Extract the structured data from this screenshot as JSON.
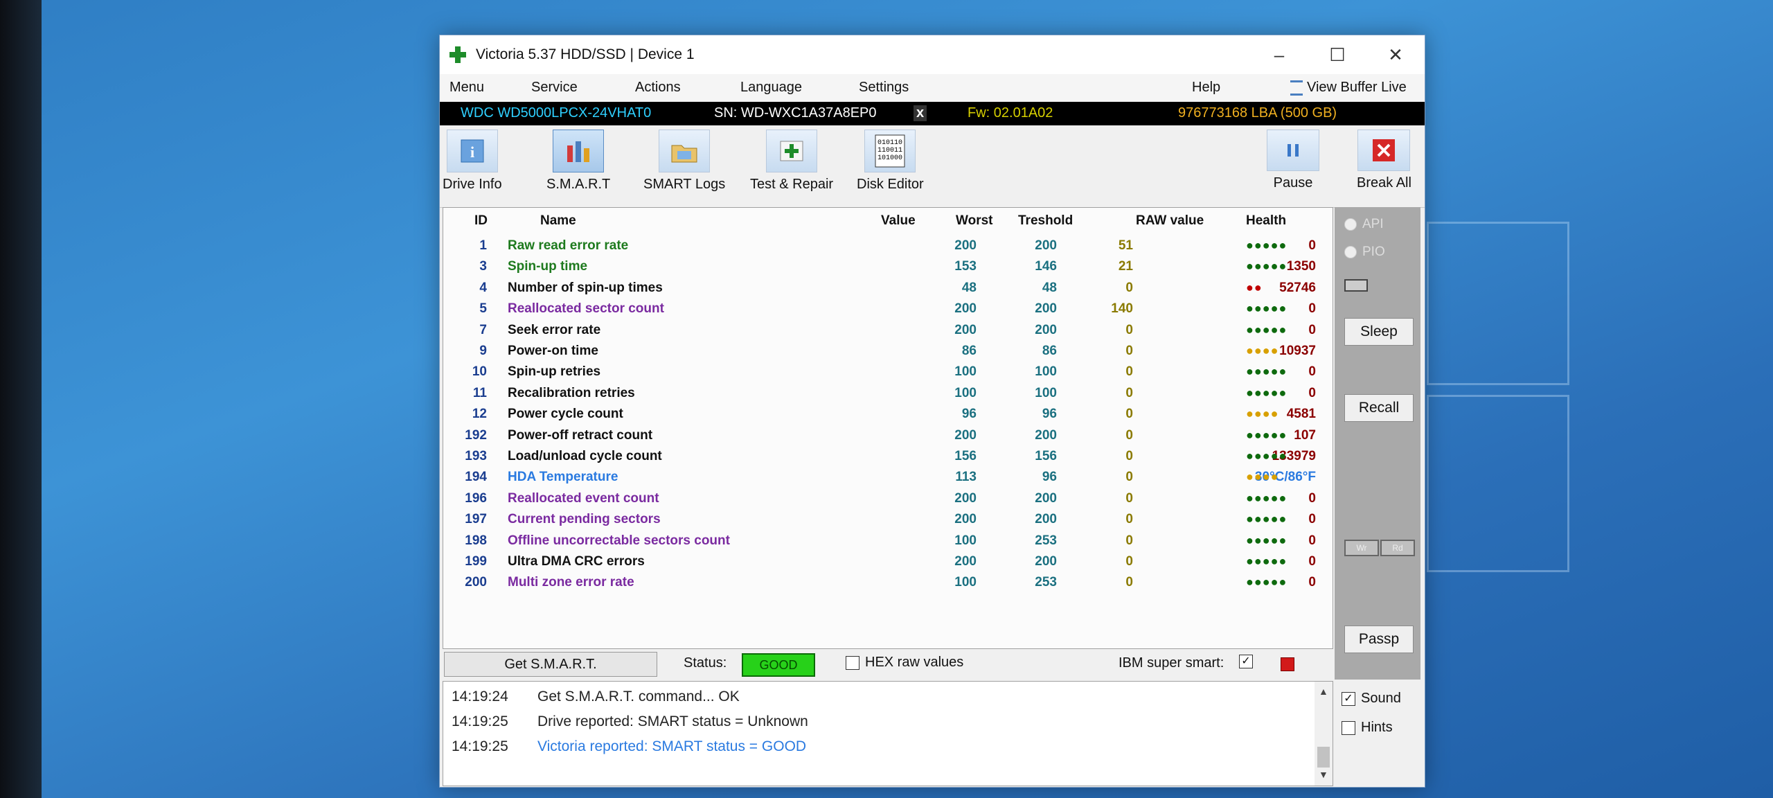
{
  "window": {
    "title": "Victoria 5.37 HDD/SSD | Device 1",
    "controls": {
      "minimize": "–",
      "maximize": "☐",
      "close": "✕"
    }
  },
  "menu": {
    "items": [
      "Menu",
      "Service",
      "Actions",
      "Language",
      "Settings"
    ],
    "help": "Help",
    "view_buffer": "View Buffer Live"
  },
  "drive": {
    "model": "WDC WD5000LPCX-24VHAT0",
    "serial": "SN: WD-WXC1A37A8EP0",
    "close_mark": "x",
    "firmware": "Fw: 02.01A02",
    "lba": "976773168 LBA (500 GB)"
  },
  "toolbar": {
    "drive_info": "Drive Info",
    "smart": "S.M.A.R.T",
    "smart_logs": "SMART Logs",
    "test_repair": "Test & Repair",
    "disk_editor": "Disk Editor",
    "pause": "Pause",
    "break_all": "Break All"
  },
  "table": {
    "headers": {
      "id": "ID",
      "name": "Name",
      "value": "Value",
      "worst": "Worst",
      "threshold": "Treshold",
      "raw": "RAW value",
      "health": "Health"
    },
    "rows": [
      {
        "id": "1",
        "name": "Raw read error rate",
        "value": "200",
        "worst": "200",
        "threshold": "51",
        "raw": "0",
        "health": "●●●●●",
        "name_color": "#1e7a1e",
        "health_color": "#0e6a0e"
      },
      {
        "id": "3",
        "name": "Spin-up time",
        "value": "153",
        "worst": "146",
        "threshold": "21",
        "raw": "1350",
        "health": "●●●●●",
        "name_color": "#1e7a1e",
        "health_color": "#0e6a0e"
      },
      {
        "id": "4",
        "name": "Number of spin-up times",
        "value": "48",
        "worst": "48",
        "threshold": "0",
        "raw": "52746",
        "health": "●●",
        "name_color": "#111111",
        "health_color": "#c00000"
      },
      {
        "id": "5",
        "name": "Reallocated sector count",
        "value": "200",
        "worst": "200",
        "threshold": "140",
        "raw": "0",
        "health": "●●●●●",
        "name_color": "#7a2aa0",
        "health_color": "#0e6a0e"
      },
      {
        "id": "7",
        "name": "Seek error rate",
        "value": "200",
        "worst": "200",
        "threshold": "0",
        "raw": "0",
        "health": "●●●●●",
        "name_color": "#111111",
        "health_color": "#0e6a0e"
      },
      {
        "id": "9",
        "name": "Power-on time",
        "value": "86",
        "worst": "86",
        "threshold": "0",
        "raw": "10937",
        "health": "●●●●",
        "name_color": "#111111",
        "health_color": "#d8a000"
      },
      {
        "id": "10",
        "name": "Spin-up retries",
        "value": "100",
        "worst": "100",
        "threshold": "0",
        "raw": "0",
        "health": "●●●●●",
        "name_color": "#111111",
        "health_color": "#0e6a0e"
      },
      {
        "id": "11",
        "name": "Recalibration retries",
        "value": "100",
        "worst": "100",
        "threshold": "0",
        "raw": "0",
        "health": "●●●●●",
        "name_color": "#111111",
        "health_color": "#0e6a0e"
      },
      {
        "id": "12",
        "name": "Power cycle count",
        "value": "96",
        "worst": "96",
        "threshold": "0",
        "raw": "4581",
        "health": "●●●●",
        "name_color": "#111111",
        "health_color": "#d8a000"
      },
      {
        "id": "192",
        "name": "Power-off retract count",
        "value": "200",
        "worst": "200",
        "threshold": "0",
        "raw": "107",
        "health": "●●●●●",
        "name_color": "#111111",
        "health_color": "#0e6a0e"
      },
      {
        "id": "193",
        "name": "Load/unload cycle count",
        "value": "156",
        "worst": "156",
        "threshold": "0",
        "raw": "133979",
        "health": "●●●●●",
        "name_color": "#111111",
        "health_color": "#0e6a0e"
      },
      {
        "id": "194",
        "name": "HDA Temperature",
        "value": "113",
        "worst": "96",
        "threshold": "0",
        "raw": "30°C/86°F",
        "health": "●●●●",
        "name_color": "#2a7ae0",
        "health_color": "#d8a000",
        "raw_color": "#2a7ae0"
      },
      {
        "id": "196",
        "name": "Reallocated event count",
        "value": "200",
        "worst": "200",
        "threshold": "0",
        "raw": "0",
        "health": "●●●●●",
        "name_color": "#7a2aa0",
        "health_color": "#0e6a0e"
      },
      {
        "id": "197",
        "name": "Current pending sectors",
        "value": "200",
        "worst": "200",
        "threshold": "0",
        "raw": "0",
        "health": "●●●●●",
        "name_color": "#7a2aa0",
        "health_color": "#0e6a0e"
      },
      {
        "id": "198",
        "name": "Offline uncorrectable sectors count",
        "value": "100",
        "worst": "253",
        "threshold": "0",
        "raw": "0",
        "health": "●●●●●",
        "name_color": "#7a2aa0",
        "health_color": "#0e6a0e"
      },
      {
        "id": "199",
        "name": "Ultra DMA CRC errors",
        "value": "200",
        "worst": "200",
        "threshold": "0",
        "raw": "0",
        "health": "●●●●●",
        "name_color": "#111111",
        "health_color": "#0e6a0e"
      },
      {
        "id": "200",
        "name": "Multi zone error rate",
        "value": "100",
        "worst": "253",
        "threshold": "0",
        "raw": "0",
        "health": "●●●●●",
        "name_color": "#7a2aa0",
        "health_color": "#0e6a0e"
      }
    ]
  },
  "side": {
    "api": "API",
    "pio": "PIO",
    "sleep": "Sleep",
    "recall": "Recall",
    "wr": "Wr",
    "rd": "Rd",
    "passp": "Passp",
    "sound": "Sound",
    "hints": "Hints"
  },
  "status": {
    "get_smart": "Get S.M.A.R.T.",
    "status_label": "Status:",
    "status_value": "GOOD",
    "hex_raw": "HEX raw values",
    "ibm_super_smart": "IBM super smart:"
  },
  "log": [
    {
      "time": "14:19:24",
      "msg": "Get S.M.A.R.T. command... OK",
      "color": "#222222"
    },
    {
      "time": "14:19:25",
      "msg": "Drive reported: SMART status = Unknown",
      "color": "#222222"
    },
    {
      "time": "14:19:25",
      "msg": "Victoria reported: SMART status = GOOD",
      "color": "#2a7ae0"
    }
  ]
}
